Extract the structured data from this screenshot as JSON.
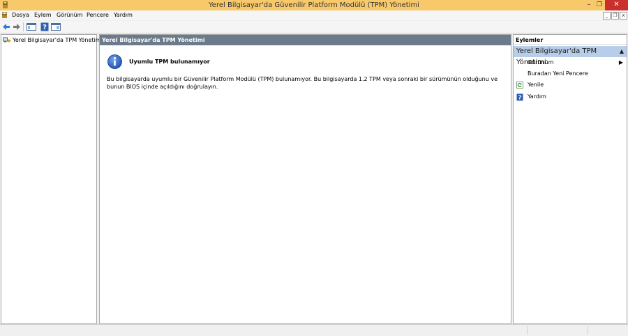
{
  "window": {
    "title": "Yerel Bilgisayar'da Güvenilir Platform Modülü (TPM) Yönetimi",
    "minimize": "–",
    "maximize": "❐",
    "close": "✕"
  },
  "menu": {
    "items": [
      "Dosya",
      "Eylem",
      "Görünüm",
      "Pencere",
      "Yardım"
    ],
    "mdi_minimize": "_",
    "mdi_restore": "❐",
    "mdi_close": "x"
  },
  "toolbar": {
    "buttons": [
      "back-icon",
      "forward-icon",
      "console-tree-icon",
      "help-icon",
      "action-pane-icon"
    ]
  },
  "tree": {
    "root_label": "Yerel Bilgisayar'da TPM Yönetimi"
  },
  "center": {
    "header": "Yerel Bilgisayar'da TPM Yönetimi",
    "info_title": "Uyumlu TPM bulunamıyor",
    "info_body": "Bu bilgisayarda uyumlu bir Güvenilir Platform Modülü (TPM) bulunamıyor. Bu bilgisayarda 1.2 TPM veya sonraki bir sürümünün olduğunu ve bunun BIOS içinde açıldığını doğrulayın."
  },
  "actions": {
    "header": "Eylemler",
    "section": "Yerel Bilgisayar'da TPM Yönetimi",
    "items": [
      "Görünüm",
      "Buradan Yeni Pencere",
      "Yenile",
      "Yardım"
    ]
  },
  "colors": {
    "titlebar": "#f7c96b",
    "close_button": "#c9302c",
    "center_header": "#6b7b8c",
    "actions_section": "#b7cde8"
  }
}
